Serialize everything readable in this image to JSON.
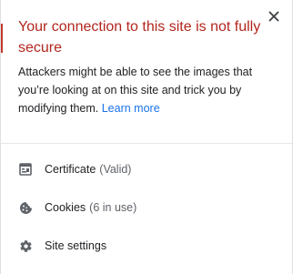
{
  "header": {
    "title": "Your connection to this site is not fully secure",
    "description": "Attackers might be able to see the images that you’re looking at on this site and trick you by modifying them.",
    "learn_more": "Learn more"
  },
  "items": [
    {
      "label": "Certificate",
      "status": "(Valid)",
      "icon": "certificate-icon"
    },
    {
      "label": "Cookies",
      "status": "(6 in use)",
      "icon": "cookie-icon"
    },
    {
      "label": "Site settings",
      "status": "",
      "icon": "gear-icon"
    }
  ],
  "colors": {
    "warning_title": "#b3261e",
    "link": "#1a73e8",
    "text": "#202124",
    "secondary_text": "#5f6368"
  }
}
